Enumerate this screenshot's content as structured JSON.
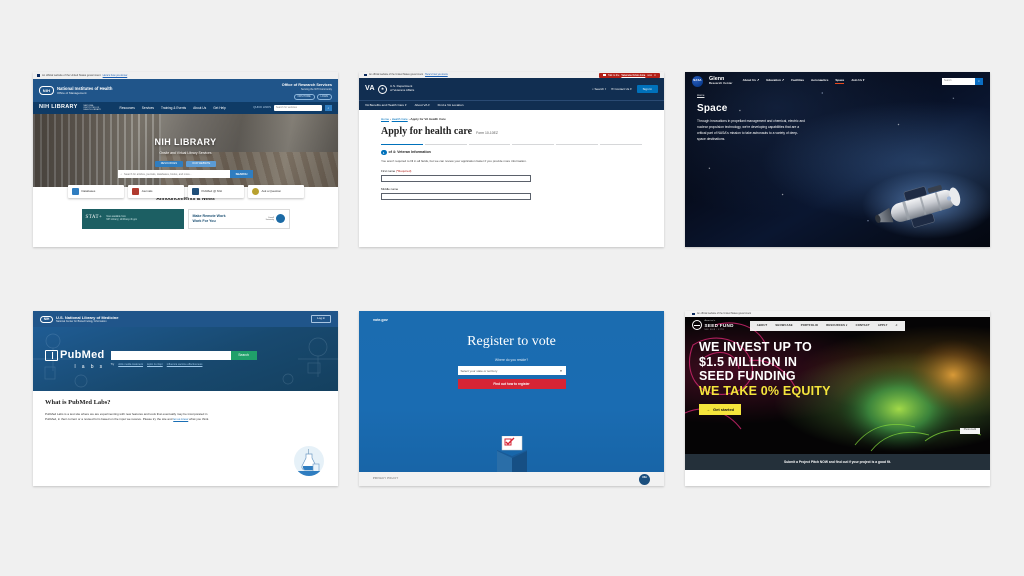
{
  "page": {
    "background": "#f0f0f0"
  },
  "cards": {
    "nih_library": {
      "gov_banner": "An official website of the United States government",
      "gov_banner_link": "Here's how you know",
      "logo_abbr": "NIH",
      "org_line1": "National Institutes of Health",
      "org_line2": "Office of Management",
      "ors_title": "Office of Research Services",
      "ors_sub": "Serving the NIH Community",
      "ors_buttons": [
        "ORS HOME",
        "LOGIN"
      ],
      "brand": "NIH LIBRARY",
      "brand_sub": "NATIONAL INSTITUTES OF HEALTH LIBRARY",
      "nav": [
        "Resources",
        "Services",
        "Training & Events",
        "About Us",
        "Get Help"
      ],
      "quick_links": "QUICK LINKS",
      "search_placeholder": "Search for websites",
      "search_icon": "search-icon",
      "hero_title": "NIH LIBRARY",
      "hero_tagline": "Onsite and Virtual Library Services",
      "hero_tabs": [
        "RESOURCES",
        "OUR WEBSITE"
      ],
      "hero_search_placeholder": "Search for articles, journals, databases, books, and more...",
      "hero_search_button": "SEARCH",
      "tiles": [
        {
          "label": "Databases",
          "icon": "database-icon",
          "color": "#2f7dc0"
        },
        {
          "label": "Journals",
          "icon": "journal-icon",
          "color": "#b03a2e"
        },
        {
          "label": "PubMed @ NIH",
          "icon": "pubmed-icon",
          "color": "#1f4e79"
        },
        {
          "label": "Ask a Question",
          "icon": "question-icon",
          "color": "#b8a02e"
        }
      ],
      "announcements_title": "Announcements & News",
      "ann1_brand": "STAT+",
      "ann1_line1": "Now available from",
      "ann1_line2": "NIH Library | nihlibrary.nih.gov",
      "ann2_line1": "Make Remote Work",
      "ann2_line2": "Work For You",
      "ann2_logo_l1": "Cornell",
      "ann2_logo_l2": "University"
    },
    "va": {
      "gov_banner": "An official website of the United States government",
      "gov_banner_link": "Here's how you know",
      "crisis_prefix": "Talk to the",
      "crisis_link": "Veterans Crisis Line",
      "crisis_suffix": "now",
      "crisis_close": "✕",
      "logo": "VA",
      "seal_icon": "va-seal-icon",
      "dept_line1": "U.S. Department",
      "dept_line2": "of Veterans Affairs",
      "search_label": "Search",
      "contact_label": "Contact Us",
      "signin_label": "Sign In",
      "nav": [
        "VA Benefits and Health Care",
        "About VA",
        "Find a VA Location"
      ],
      "breadcrumb": [
        "Home",
        "Health Care",
        "Apply for VA Health Care"
      ],
      "page_title": "Apply for health care",
      "form_number": "Form 10-10EZ",
      "progress_total": 6,
      "progress_done": 1,
      "step_number": "1",
      "step_label": "of 4: Veteran Information",
      "help_text": "You aren't required to fill in all fields, but we can review your application faster if you provide more information.",
      "field1_label": "First name",
      "field1_required": "(*Required)",
      "field1_value": "",
      "field2_label": "Middle name",
      "field2_value": ""
    },
    "nasa": {
      "logo": "NASA",
      "center_line1": "Glenn",
      "center_line2": "Research Center",
      "nav": [
        {
          "label": "About Us",
          "external": true,
          "active": false
        },
        {
          "label": "Education",
          "external": true,
          "active": false
        },
        {
          "label": "Facilities",
          "external": false,
          "active": false
        },
        {
          "label": "Aeronautics",
          "external": false,
          "active": false
        },
        {
          "label": "Space",
          "external": false,
          "active": true
        },
        {
          "label": "Join Us",
          "external": false,
          "active": false
        }
      ],
      "search_placeholder": "Search",
      "search_icon": "search-icon",
      "breadcrumb": "Home",
      "title": "Space",
      "body": "Through innovations in propellant management and chemical, electric and nuclear propulsion technology, we're developing capabilities that are a critical part of NASA's mission to take astronauts to a variety of deep-space destinations.",
      "accent": "#e8491d"
    },
    "pubmed": {
      "logo_abbr": "NIH",
      "org_line1": "U.S. National Library of Medicine",
      "org_line2": "National Center for Biotechnology Information",
      "login_label": "Log in",
      "brand_word": "PubMed",
      "brand_sub": "l a b s",
      "search_value": "",
      "search_button": "Search",
      "try_label": "Try",
      "try_links": [
        "otitis media treatment",
        "leptin & crispr",
        "influenza vaccine effectiveness"
      ],
      "section_title": "What is PubMed Labs?",
      "section_body_1": "PubMed Labs is a test site where we are experimenting with new features and tools that eventually may be incorporated in PubMed, in their current or a revised form based on the input we receive. Please try the site and ",
      "section_link": "let us know",
      "section_body_2": " what you think.",
      "illustration": "lab-flask-icon"
    },
    "vote": {
      "brand": "vote.gov",
      "title": "Register to vote",
      "question": "Where do you reside?",
      "select_value": "Select your state or territory",
      "select_icon": "chevron-down-icon",
      "button_label": "Find out how to register",
      "ballot_icon": "ballot-box-icon",
      "footer_link": "PRIVACY POLICY",
      "seal_text": "USA",
      "accent": "#d62435"
    },
    "seedfund": {
      "gov_banner": "An official website of the United States government",
      "logo_l1": "America's",
      "logo_l2": "SEED FUND",
      "logo_l3": "NSF SBIR / STTR",
      "nav": [
        "ABOUT",
        "SHOWCASE",
        "PORTFOLIO",
        "RESOURCES",
        "CONTACT",
        "APPLY"
      ],
      "search_icon": "search-icon",
      "headline_line1": "WE INVEST UP TO",
      "headline_line2": "$1.5 MILLION IN",
      "headline_line3": "SEED FUNDING",
      "headline_line4": "WE TAKE 0% EQUITY",
      "cta_label": "Get started",
      "cta_arrow": "→",
      "photo_credit": "Photo credit",
      "bottom_bar": "Submit a Project Pitch NOW and find out if your project is a good fit.",
      "accent": "#f5e53c"
    }
  }
}
